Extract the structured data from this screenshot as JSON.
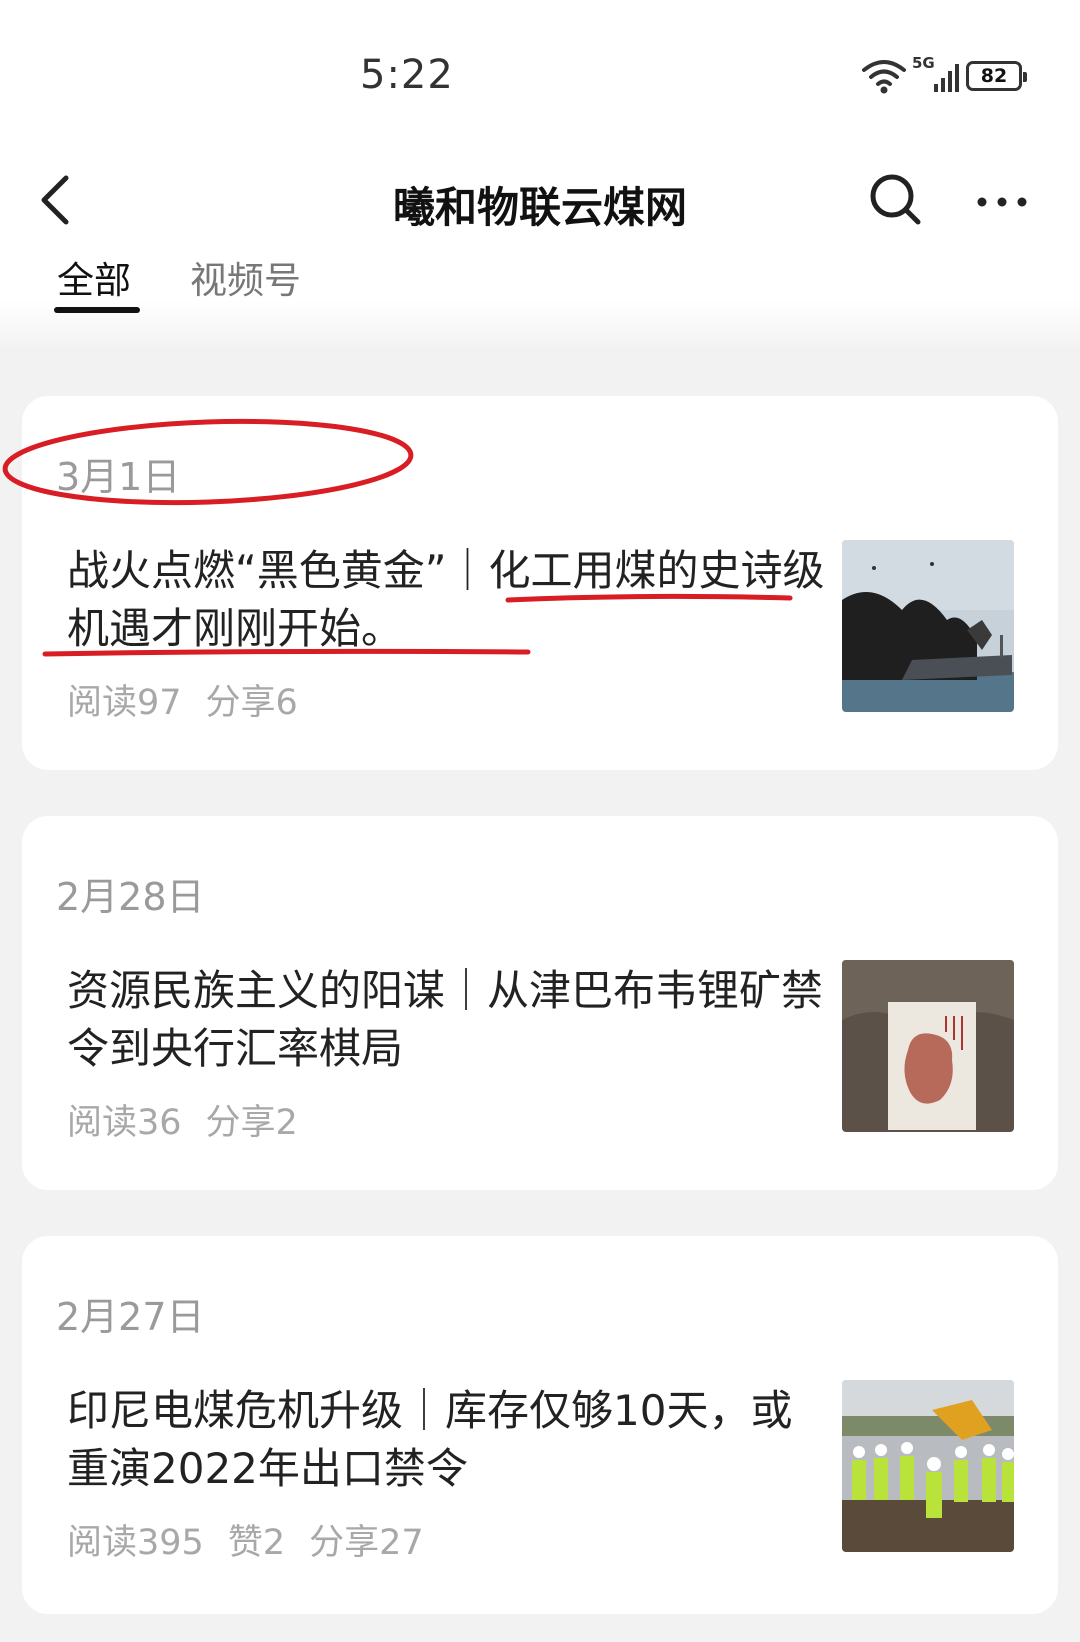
{
  "status": {
    "time": "5:22",
    "network": "5G",
    "battery": "82"
  },
  "header": {
    "title": "曦和物联云煤网"
  },
  "tabs": [
    {
      "label": "全部",
      "active": true
    },
    {
      "label": "视频号",
      "active": false
    }
  ],
  "articles": [
    {
      "date": "3月1日",
      "title": "战火点燃“黑色黄金”｜化工用煤的史诗级机遇才刚刚开始。",
      "stats": {
        "reads": "阅读97",
        "likes": "",
        "shares": "分享6"
      }
    },
    {
      "date": "2月28日",
      "title": "资源民族主义的阳谋｜从津巴布韦锂矿禁令到央行汇率棋局",
      "stats": {
        "reads": "阅读36",
        "likes": "",
        "shares": "分享2"
      }
    },
    {
      "date": "2月27日",
      "title": "印尼电煤危机升级｜库存仅够10天，或重演2022年出口禁令",
      "stats": {
        "reads": "阅读395",
        "likes": "赞2",
        "shares": "分享27"
      }
    }
  ],
  "colors": {
    "annotation": "#d81e24",
    "text": "#222222",
    "meta": "#a8a8a8"
  }
}
